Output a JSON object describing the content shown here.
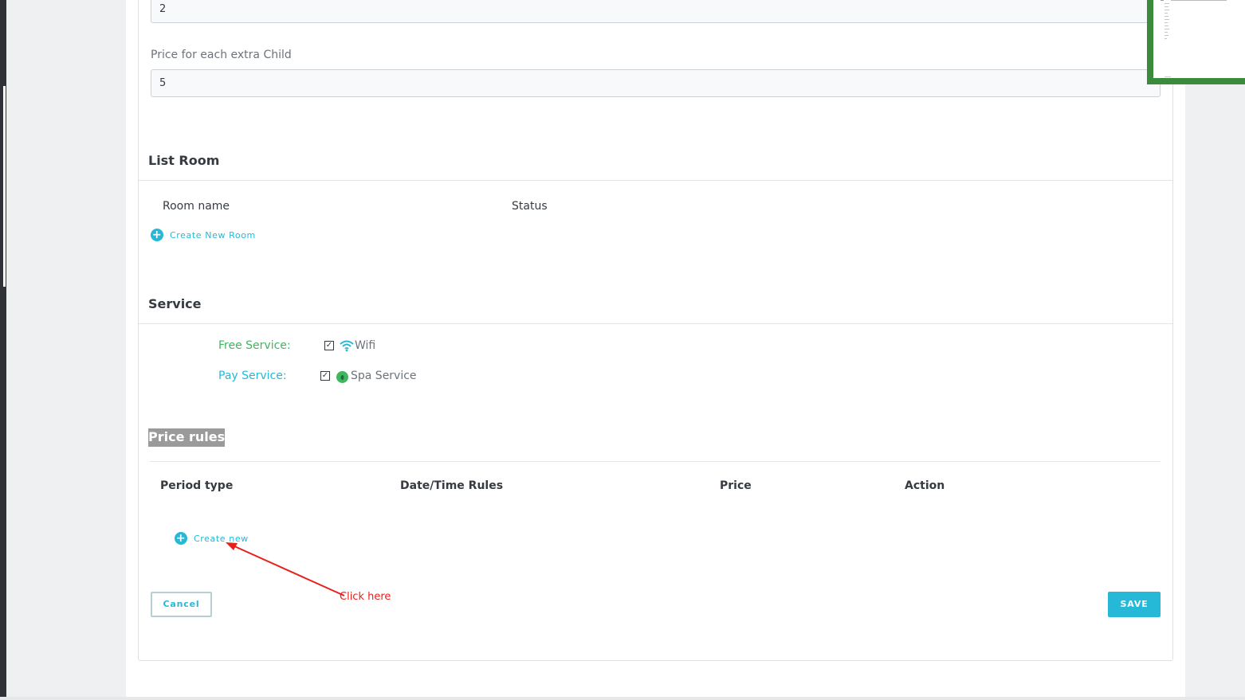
{
  "form": {
    "extra_adult_value": "2",
    "extra_child_label": "Price for each extra Child",
    "extra_child_value": "5"
  },
  "list_room": {
    "title": "List Room",
    "columns": [
      "Room name",
      "Status"
    ],
    "create_label": "Create New Room"
  },
  "service": {
    "title": "Service",
    "free_label": "Free Service:",
    "free_item": "Wifi",
    "free_checked": true,
    "free_icon": "wifi-icon",
    "pay_label": "Pay Service:",
    "pay_item": "Spa Service",
    "pay_checked": true,
    "pay_icon": "spa-icon"
  },
  "price_rules": {
    "title": "Price rules",
    "columns": [
      "Period type",
      "Date/Time Rules",
      "Price",
      "Action"
    ],
    "create_label": "Create new"
  },
  "actions": {
    "cancel_label": "Cancel",
    "save_label": "SAVE"
  },
  "annotation": {
    "text": "Click here"
  },
  "colors": {
    "accent": "#25b9d7",
    "free_service": "#3fb65f",
    "pay_service": "#25b9d7",
    "annotation": "#e8201c",
    "highlight": "#9a9a9a"
  }
}
